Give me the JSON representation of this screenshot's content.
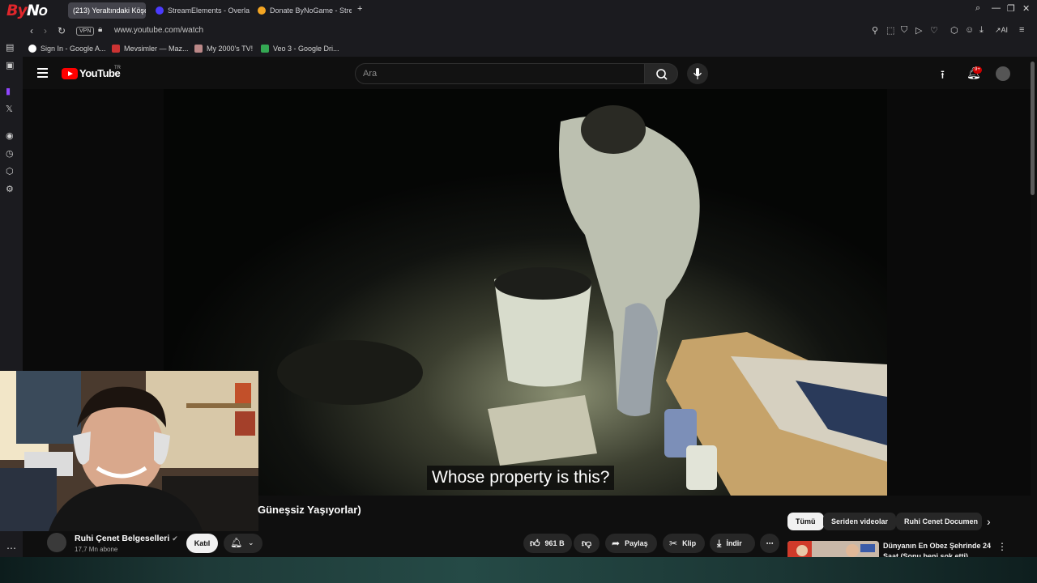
{
  "browser": {
    "logo": {
      "text_a": "By",
      "text_b": "N",
      "text_c": "O"
    },
    "tabs": [
      {
        "label": "(213) Yeraltındaki Köşe",
        "active": true,
        "color": "#ff0000"
      },
      {
        "label": "StreamElements - Overlay",
        "active": false,
        "color": "#4b3bff"
      },
      {
        "label": "Donate ByNoGame - Strea",
        "active": false,
        "color": "#f5a623"
      }
    ],
    "new_tab": "+",
    "url": "www.youtube.com/watch",
    "vpn_label": "VPN",
    "bookmarks": [
      {
        "label": "Sign In - Google A...",
        "color": "#ffffff"
      },
      {
        "label": "Mevsimler — Maz...",
        "color": "#d33"
      },
      {
        "label": "My 2000's TV!",
        "color": "#b88"
      },
      {
        "label": "Veo 3 - Google Dri...",
        "color": "#34a853"
      }
    ],
    "ext_ai": "AI"
  },
  "youtube": {
    "logo_text": "YouTube",
    "region": "TR",
    "search_placeholder": "Ara",
    "notif_count": "9+"
  },
  "video": {
    "subtitle": "Whose property is this?",
    "title": "Güneşsiz Yaşıyorlar)"
  },
  "channel": {
    "name": "Ruhi Çenet Belgeselleri",
    "subs": "17,7 Mn abone",
    "join": "Katıl"
  },
  "actions": {
    "likes": "961 B",
    "share": "Paylaş",
    "clip": "Klip",
    "download": "İndir"
  },
  "chips": [
    {
      "label": "Tümü",
      "active": true
    },
    {
      "label": "Seriden videolar",
      "active": false
    },
    {
      "label": "Ruhi Cenet Documen",
      "active": false
    }
  ],
  "recommendation": {
    "title": "Dünyanın En Obez Şehrinde 24 Saat (Sonu beni şok etti)"
  }
}
